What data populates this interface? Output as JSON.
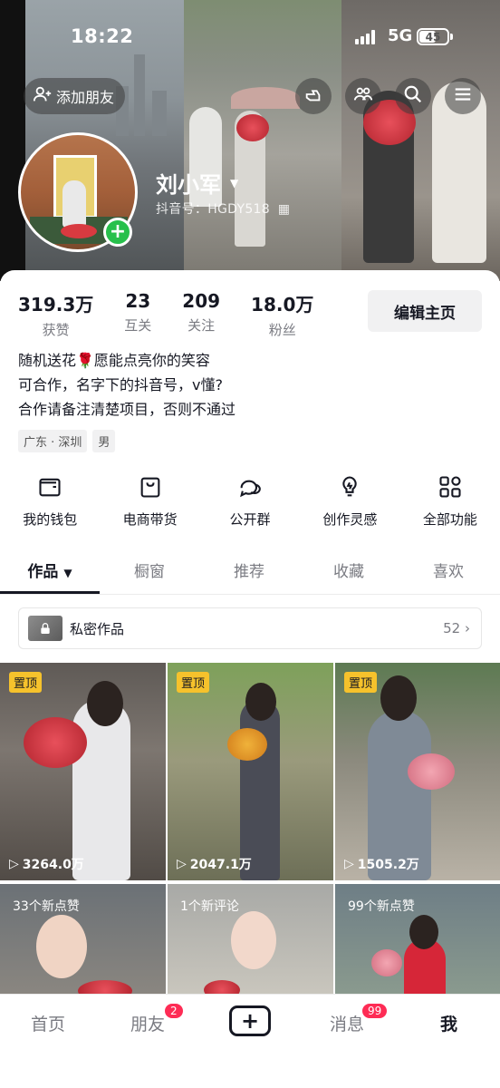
{
  "status": {
    "time": "18:22",
    "network": "5G",
    "battery": "45"
  },
  "header": {
    "add_friend": "添加朋友"
  },
  "profile": {
    "nickname": "刘小军",
    "douyin_id": "抖音号：HGDY518"
  },
  "stats": [
    {
      "value": "319.3万",
      "label": "获赞"
    },
    {
      "value": "23",
      "label": "互关"
    },
    {
      "value": "209",
      "label": "关注"
    },
    {
      "value": "18.0万",
      "label": "粉丝"
    }
  ],
  "edit_button": "编辑主页",
  "bio": {
    "line1": "随机送花🌹愿能点亮你的笑容",
    "line2": "可合作，名字下的抖音号，v懂?",
    "line3": "合作请备注清楚项目，否则不通过"
  },
  "tags": [
    "广东 · 深圳",
    "男"
  ],
  "functions": [
    {
      "icon": "wallet-icon",
      "label": "我的钱包"
    },
    {
      "icon": "shopping-bag-icon",
      "label": "电商带货"
    },
    {
      "icon": "group-chat-icon",
      "label": "公开群"
    },
    {
      "icon": "lightbulb-icon",
      "label": "创作灵感"
    },
    {
      "icon": "grid-icon",
      "label": "全部功能"
    }
  ],
  "tabs": [
    "作品",
    "橱窗",
    "推荐",
    "收藏",
    "喜欢"
  ],
  "private": {
    "label": "私密作品",
    "count": "52"
  },
  "videos": [
    {
      "pin": "置顶",
      "views": "3264.0万"
    },
    {
      "pin": "置顶",
      "views": "2047.1万"
    },
    {
      "pin": "置顶",
      "views": "1505.2万"
    },
    {
      "notice": "33个新点赞"
    },
    {
      "notice": "1个新评论"
    },
    {
      "notice": "99个新点赞"
    }
  ],
  "bottom_nav": {
    "home": "首页",
    "friends": "朋友",
    "friends_badge": "2",
    "messages": "消息",
    "messages_badge": "99",
    "me": "我"
  },
  "colors": {
    "accent": "#fe2c55",
    "pin": "#f6c22c",
    "add": "#27c04b"
  }
}
